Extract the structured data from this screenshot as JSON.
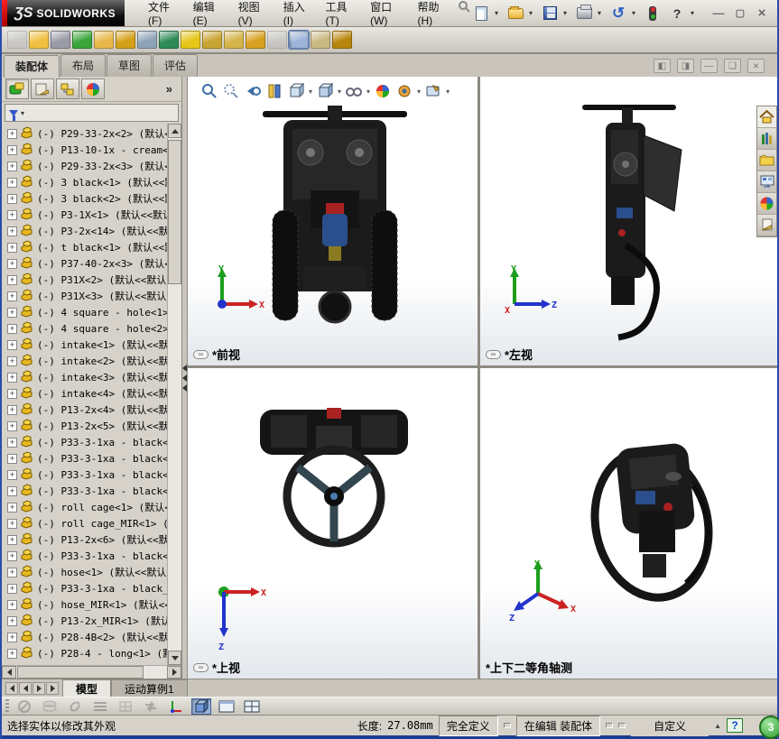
{
  "window": {
    "logo_prefix": "ƷS",
    "logo_text": "SOLIDWORKS",
    "minimize": "—",
    "restore": "▢",
    "close": "×"
  },
  "menu": {
    "items": [
      "文件(F)",
      "编辑(E)",
      "视图(V)",
      "插入(I)",
      "工具(T)",
      "窗口(W)",
      "帮助(H)"
    ]
  },
  "quickbar_icons": [
    "new-document-icon",
    "open-icon",
    "save-icon",
    "print-icon",
    "undo-icon",
    "options-lights-icon",
    "help-icon"
  ],
  "assembly_toolbar_icons": [
    {
      "name": "insert-component-disabled-icon",
      "color": "#c2c2c2",
      "disabled": true
    },
    {
      "name": "insert-component-icon",
      "color": "#f0c040",
      "drop": true
    },
    {
      "name": "mate-icon",
      "color": "#9a9aa8"
    },
    {
      "name": "linear-pattern-icon",
      "color": "#3aa63a",
      "drop": true
    },
    {
      "name": "new-part-icon",
      "color": "#e8b84b"
    },
    {
      "name": "rotate-component-icon",
      "color": "#d4a017",
      "drop": true
    },
    {
      "name": "assembly-features-icon",
      "color": "#8fa3b8"
    },
    {
      "name": "smart-fasteners-icon",
      "color": "#2e8b57",
      "drop": true
    },
    {
      "name": "sketch-driven-icon",
      "color": "#e6c619",
      "drop": true
    },
    {
      "name": "motion-study-icon",
      "color": "#c8a432"
    },
    {
      "name": "window-preview-icon",
      "color": "#d4b44a"
    },
    {
      "name": "move-component-icon",
      "color": "#d8a020"
    },
    {
      "name": "show-hidden-disabled-icon",
      "color": "#bdbdbd",
      "disabled": true
    },
    {
      "name": "interference-detection-icon",
      "color": "#5d87c0",
      "pressed": true
    },
    {
      "name": "exploded-view-icon",
      "color": "#c8b882"
    },
    {
      "name": "photo-render-icon",
      "color": "#b8860b"
    }
  ],
  "command_tabs": {
    "items": [
      {
        "label": "装配体",
        "active": true
      },
      {
        "label": "布局",
        "active": false
      },
      {
        "label": "草图",
        "active": false
      },
      {
        "label": "评估",
        "active": false
      }
    ]
  },
  "feature_panel": {
    "chevron": "»",
    "panel_tab_icons": [
      "featuremanager-tree-icon",
      "propertymanager-icon",
      "configurationmanager-icon",
      "displaymanager-icon"
    ],
    "tree_items": [
      "(-) P29-33-2x<2> (默认<",
      "(-) P13-10-1x - cream<1",
      "(-) P29-33-2x<3> (默认<",
      "(-) 3 black<1> (默认<<默",
      "(-) 3 black<2> (默认<<默",
      "(-) P3-1X<1> (默认<<默认",
      "(-) P3-2x<14> (默认<<默",
      "(-) t black<1> (默认<<默",
      "(-) P37-40-2x<3> (默认<",
      "(-) P31X<2> (默认<<默认",
      "(-) P31X<3> (默认<<默认",
      "(-) 4 square - hole<1>",
      "(-) 4 square - hole<2>",
      "(-) intake<1> (默认<<默",
      "(-) intake<2> (默认<<默",
      "(-) intake<3> (默认<<默",
      "(-) intake<4> (默认<<默",
      "(-) P13-2x<4> (默认<<默",
      "(-) P13-2x<5> (默认<<默",
      "(-) P33-3-1xa - black<1",
      "(-) P33-3-1xa - black<2",
      "(-) P33-3-1xa - black<3",
      "(-) P33-3-1xa - black<4",
      "(-) roll cage<1> (默认<",
      "(-) roll cage_MIR<1> (默",
      "(-) P13-2x<6> (默认<<默",
      "(-) P33-3-1xa - black<5",
      "(-) hose<1> (默认<<默认",
      "(-) P33-3-1xa - black_M",
      "(-) hose_MIR<1> (默认<<",
      "(-) P13-2x_MIR<1> (默认",
      "(-) P28-4B<2> (默认<<默",
      "(-) P28-4 - long<1> (默"
    ]
  },
  "viewport_toolbar_icons": [
    "zoom-to-fit-icon",
    "zoom-to-area-icon",
    "previous-view-icon",
    "section-view-icon",
    "view-orientation-icon",
    "display-style-icon",
    "hide-show-items-icon",
    "edit-appearance-icon",
    "apply-scene-icon",
    "view-settings-icon"
  ],
  "mdi_buttons": [
    "tile-horizontal-icon",
    "tile-vertical-icon",
    "minimize-child-icon",
    "restore-child-icon",
    "close-child-icon"
  ],
  "taskpane_icons": [
    "resources-home-icon",
    "design-library-icon",
    "file-explorer-icon",
    "view-palette-icon",
    "appearances-icon",
    "custom-properties-icon"
  ],
  "viewports": [
    {
      "label": "*前视",
      "linked": true,
      "axes": {
        "up": "Y",
        "right": "X"
      }
    },
    {
      "label": "*左视",
      "linked": true,
      "axes": {
        "up": "Y",
        "right": "Z",
        "origin": "X"
      }
    },
    {
      "label": "*上视",
      "linked": true,
      "axes": {
        "right": "X",
        "down": "Z"
      }
    },
    {
      "label": "*上下二等角轴测",
      "linked": false,
      "axes": {
        "up": "Y",
        "right": "X",
        "left": "Z"
      }
    }
  ],
  "model_tabs": {
    "items": [
      {
        "label": "模型",
        "active": true
      },
      {
        "label": "运动算例1",
        "active": false
      }
    ]
  },
  "statusbar": {
    "message": "选择实体以修改其外观",
    "length_label": "长度:",
    "length_value": "27.08mm",
    "fully_defined": "完全定义",
    "editing": "在编辑  装配体",
    "custom": "自定义",
    "help_glyph": "?",
    "badge": "3",
    "colors": {
      "accent_blue": "#2b4f8c",
      "status_green": "#2e9b2e",
      "red_stripe": "#cc0000"
    }
  }
}
